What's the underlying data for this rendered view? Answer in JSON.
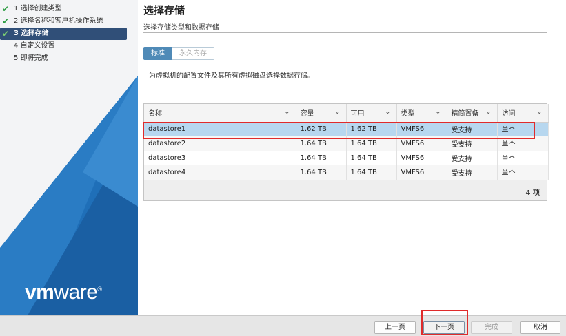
{
  "wizard": {
    "steps": [
      {
        "number": "1",
        "label": "选择创建类型",
        "done": true
      },
      {
        "number": "2",
        "label": "选择名称和客户机操作系统",
        "done": true
      },
      {
        "number": "3",
        "label": "选择存储",
        "done": true,
        "active": true
      },
      {
        "number": "4",
        "label": "自定义设置",
        "done": false
      },
      {
        "number": "5",
        "label": "即将完成",
        "done": false
      }
    ],
    "check_glyph": "✔",
    "brand": {
      "bold": "vm",
      "light": "ware",
      "mark": "®"
    }
  },
  "page": {
    "title": "选择存储",
    "subtitle": "选择存储类型和数据存储",
    "tabs": [
      {
        "label": "标准",
        "selected": true
      },
      {
        "label": "永久内存",
        "disabled": true
      }
    ],
    "description": "为虚拟机的配置文件及其所有虚拟磁盘选择数据存储。"
  },
  "table": {
    "columns": [
      "名称",
      "容量",
      "可用",
      "类型",
      "精简置备",
      "访问"
    ],
    "rows": [
      [
        "datastore1",
        "1.62 TB",
        "1.62 TB",
        "VMFS6",
        "受支持",
        "单个"
      ],
      [
        "datastore2",
        "1.64 TB",
        "1.64 TB",
        "VMFS6",
        "受支持",
        "单个"
      ],
      [
        "datastore3",
        "1.64 TB",
        "1.64 TB",
        "VMFS6",
        "受支持",
        "单个"
      ],
      [
        "datastore4",
        "1.64 TB",
        "1.64 TB",
        "VMFS6",
        "受支持",
        "单个"
      ]
    ],
    "selected_row": 0,
    "count": "4 项"
  },
  "buttons": {
    "back": "上一页",
    "next": "下一页",
    "finish": "完成",
    "cancel": "取消"
  },
  "colors": {
    "accent": "#304f78",
    "tab_selected": "#4f8ab7",
    "row_selected": "#b7d7ef",
    "highlight_box": "#e02b2b",
    "brand_blue": "#1f6fb8"
  }
}
